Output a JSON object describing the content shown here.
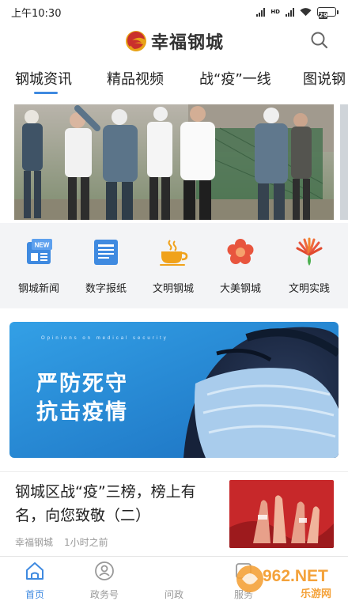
{
  "status_bar": {
    "time": "上午10:30",
    "network": "HD",
    "battery": "29"
  },
  "header": {
    "brand_name": "幸福钢城"
  },
  "tabs": [
    {
      "label": "钢城资讯",
      "active": true
    },
    {
      "label": "精品视频",
      "active": false
    },
    {
      "label": "战“疫”一线",
      "active": false
    },
    {
      "label": "图说钢",
      "active": false
    }
  ],
  "quick_menu": [
    {
      "label": "钢城新闻",
      "icon": "newspaper-new-icon",
      "badge": "NEW"
    },
    {
      "label": "数字报纸",
      "icon": "digital-paper-icon"
    },
    {
      "label": "文明钢城",
      "icon": "coffee-cup-icon"
    },
    {
      "label": "大美钢城",
      "icon": "flower-icon"
    },
    {
      "label": "文明实践",
      "icon": "fan-emblem-icon"
    }
  ],
  "promo": {
    "line1": "严防死守",
    "line2": "抗击疫情",
    "caption": "Opinions on medical security"
  },
  "news": {
    "title": "钢城区战“疫”三榜，榜上有名，向您致敬（二）",
    "source": "幸福钢城",
    "time": "1小时之前"
  },
  "bottom_nav": [
    {
      "label": "首页",
      "icon": "home-icon",
      "active": true
    },
    {
      "label": "政务号",
      "icon": "government-account-icon",
      "active": false
    },
    {
      "label": "问政",
      "icon": "inquiry-icon",
      "active": false
    },
    {
      "label": "服务",
      "icon": "service-icon",
      "active": false
    }
  ],
  "watermark": {
    "text": "962.NET",
    "subtext": "乐游网"
  },
  "colors": {
    "accent": "#3f8ae0",
    "brand_red": "#c9302c",
    "promo_blue": "#2a8ed6"
  }
}
